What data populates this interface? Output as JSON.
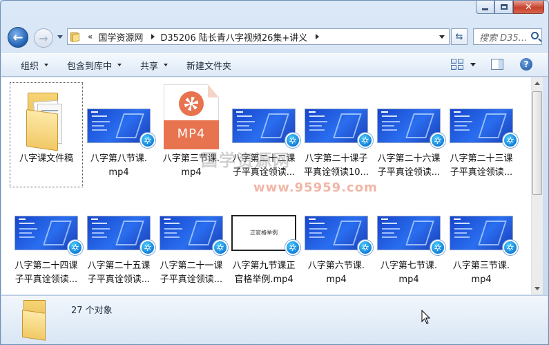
{
  "window": {
    "caption_buttons": [
      "minimize",
      "maximize",
      "close"
    ]
  },
  "nav": {
    "back_icon": "back-arrow-icon",
    "forward_icon": "forward-arrow-icon"
  },
  "address": {
    "overflow": "«",
    "crumbs": [
      "国学资源网",
      "D35206 陆长青八字视频26集+讲义"
    ]
  },
  "search": {
    "placeholder": "搜索 D35..."
  },
  "commandbar": {
    "organize": "组织",
    "include_in_library": "包含到库中",
    "share": "共享",
    "new_folder": "新建文件夹"
  },
  "files": [
    {
      "name": "八字课文件稿",
      "type": "folder"
    },
    {
      "name": "八字第八节课.mp4",
      "type": "video"
    },
    {
      "name": "八字第三节课.mp4",
      "type": "mp4-generic"
    },
    {
      "name": "八字第二十二课子平真诠领读...",
      "type": "video"
    },
    {
      "name": "八字第二十课子平真诠领读10...",
      "type": "video"
    },
    {
      "name": "八字第二十六课子平真诠领读...",
      "type": "video"
    },
    {
      "name": "八字第二十三课子平真诠领读...",
      "type": "video"
    },
    {
      "name": "八字第二十四课子平真诠领读...",
      "type": "video"
    },
    {
      "name": "八字第二十五课子平真诠领读...",
      "type": "video"
    },
    {
      "name": "八字第二十一课子平真诠领读...",
      "type": "video"
    },
    {
      "name": "八字第九节课正官格举例.mp4",
      "type": "video-white",
      "thumb_text": "正官格举例"
    },
    {
      "name": "八字第六节课.mp4",
      "type": "video"
    },
    {
      "name": "八字第七节课.mp4",
      "type": "video"
    },
    {
      "name": "八字第三节课.mp4",
      "type": "video"
    }
  ],
  "labels": [
    [
      "八字课文件稿"
    ],
    [
      "八字第八节课.",
      "mp4"
    ],
    [
      "八字第三节课.",
      "mp4"
    ],
    [
      "八字第二十二课",
      "子平真诠领读..."
    ],
    [
      "八字第二十课子",
      "平真诠领读10..."
    ],
    [
      "八字第二十六课",
      "子平真诠领读..."
    ],
    [
      "八字第二十三课",
      "子平真诠领读..."
    ],
    [
      "八字第二十四课",
      "子平真诠领读..."
    ],
    [
      "八字第二十五课",
      "子平真诠领读..."
    ],
    [
      "八字第二十一课",
      "子平真诠领读..."
    ],
    [
      "八字第九节课正",
      "官格举例.mp4"
    ],
    [
      "八字第六节课.",
      "mp4"
    ],
    [
      "八字第七节课.",
      "mp4"
    ],
    [
      "八字第三节课.",
      "mp4"
    ]
  ],
  "mp4_badge": "MP4",
  "watermark": {
    "text": "国学资源网",
    "number": "www.95959.com"
  },
  "details": {
    "count": "27 个对象"
  }
}
